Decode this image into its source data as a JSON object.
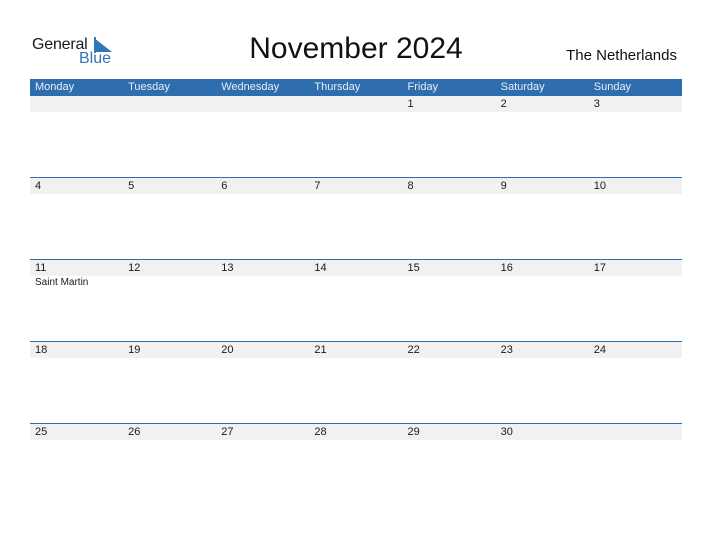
{
  "logo": {
    "general": "General",
    "blue": "Blue"
  },
  "title": "November 2024",
  "country": "The Netherlands",
  "colors": {
    "header": "#2e6eae",
    "strip": "#f1f1f1",
    "brand": "#2f76bb"
  },
  "weekdays": [
    "Monday",
    "Tuesday",
    "Wednesday",
    "Thursday",
    "Friday",
    "Saturday",
    "Sunday"
  ],
  "weeks": [
    {
      "days": [
        "",
        "",
        "",
        "",
        "1",
        "2",
        "3"
      ],
      "events": [
        "",
        "",
        "",
        "",
        "",
        "",
        ""
      ]
    },
    {
      "days": [
        "4",
        "5",
        "6",
        "7",
        "8",
        "9",
        "10"
      ],
      "events": [
        "",
        "",
        "",
        "",
        "",
        "",
        ""
      ]
    },
    {
      "days": [
        "11",
        "12",
        "13",
        "14",
        "15",
        "16",
        "17"
      ],
      "events": [
        "Saint Martin",
        "",
        "",
        "",
        "",
        "",
        ""
      ]
    },
    {
      "days": [
        "18",
        "19",
        "20",
        "21",
        "22",
        "23",
        "24"
      ],
      "events": [
        "",
        "",
        "",
        "",
        "",
        "",
        ""
      ]
    },
    {
      "days": [
        "25",
        "26",
        "27",
        "28",
        "29",
        "30",
        ""
      ],
      "events": [
        "",
        "",
        "",
        "",
        "",
        "",
        ""
      ]
    }
  ]
}
